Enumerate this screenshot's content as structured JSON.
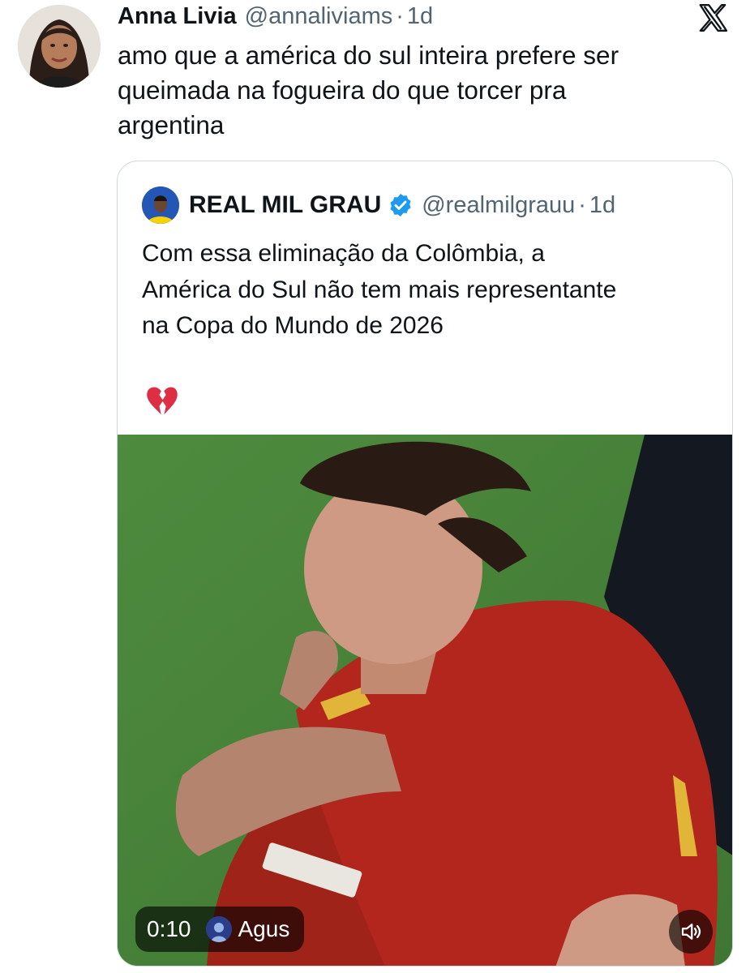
{
  "tweet": {
    "author_name": "Anna Livia",
    "author_handle": "@annaliviams",
    "separator": "·",
    "timestamp": "1d",
    "text": "amo que a américa do sul inteira prefere ser\nqueimada na fogueira do que torcer pra\nargentina"
  },
  "quoted_tweet": {
    "author_name": "REAL MIL GRAU",
    "verified": true,
    "author_handle": "@realmilgrauu",
    "separator": "·",
    "timestamp": "1d",
    "text": "Com essa eliminação da Colômbia, a\nAmérica do Sul não tem mais representante\nna Copa do Mundo de 2026",
    "emoji_icon": "broken-heart-icon",
    "media": {
      "type": "video",
      "duration": "0:10",
      "uploader": "Agus",
      "sound_icon": "speaker-muted-icon"
    }
  },
  "platform_icon": "x-logo-icon",
  "colors": {
    "text_primary": "#0f1419",
    "text_secondary": "#536471",
    "border": "#cfd9de",
    "verified_blue": "#1d9bf0",
    "jersey_red": "#b3261e"
  }
}
